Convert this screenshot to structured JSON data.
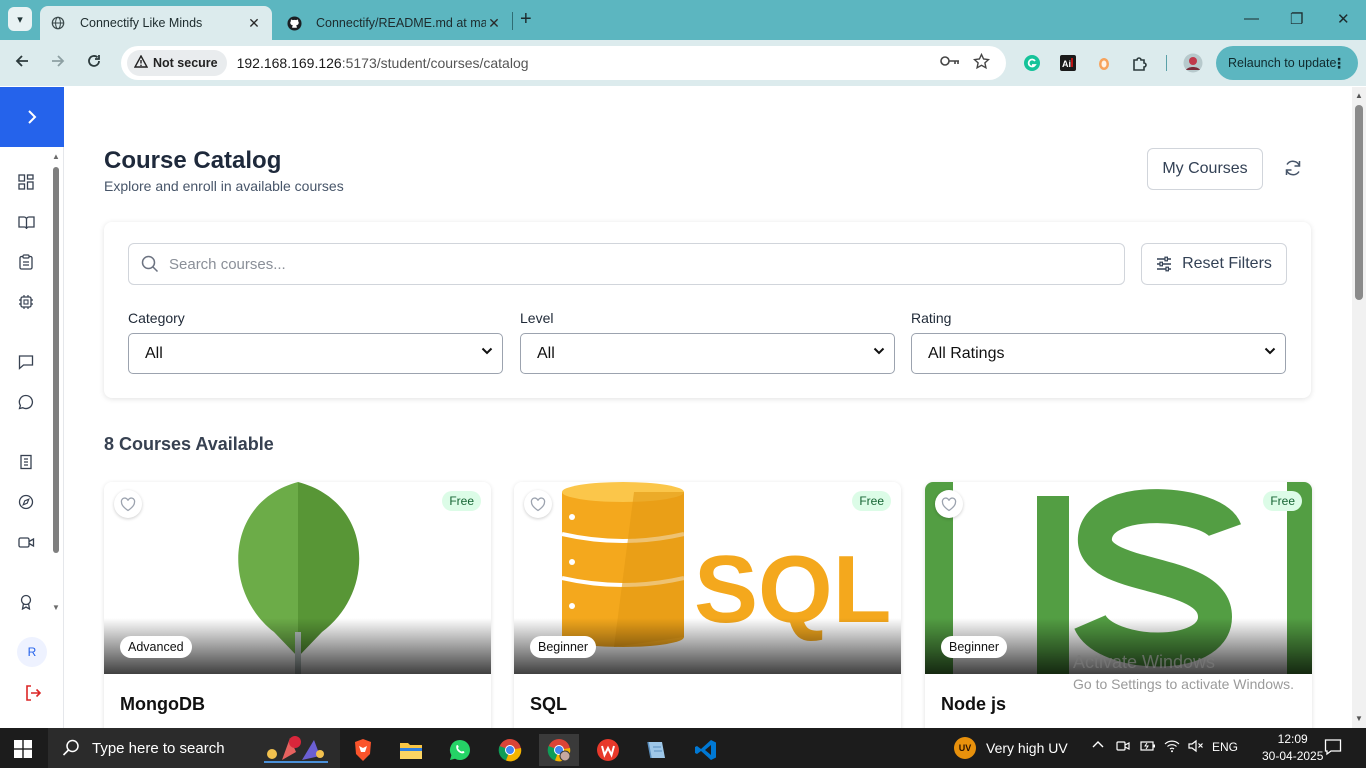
{
  "browser": {
    "tabs": [
      {
        "title": "Connectify Like Minds",
        "active": true
      },
      {
        "title": "Connectify/README.md at main",
        "active": false
      }
    ],
    "new_tab_symbol": "+",
    "not_secure_label": "Not secure",
    "url_host": "192.168.169.126",
    "url_path": ":5173/student/courses/catalog",
    "relaunch_label": "Relaunch to update",
    "relaunch_menu": "⋮"
  },
  "sidebar": {
    "avatar_initial": "R",
    "items": [
      "dashboard-icon",
      "book-icon",
      "clipboard-icon",
      "chip-icon",
      "message-square-icon",
      "message-circle-icon",
      "building-icon",
      "compass-icon",
      "video-icon",
      "award-icon"
    ]
  },
  "header": {
    "title": "Course Catalog",
    "subtitle": "Explore and enroll in available courses",
    "my_courses_label": "My Courses"
  },
  "filters": {
    "search_placeholder": "Search courses...",
    "reset_label": "Reset Filters",
    "category": {
      "label": "Category",
      "value": "All"
    },
    "level": {
      "label": "Level",
      "value": "All"
    },
    "rating": {
      "label": "Rating",
      "value": "All Ratings"
    }
  },
  "courses": {
    "count_label": "8 Courses Available",
    "items": [
      {
        "title": "MongoDB",
        "level": "Advanced",
        "price": "Free"
      },
      {
        "title": "SQL",
        "level": "Beginner",
        "price": "Free",
        "image_text": "SQL"
      },
      {
        "title": "Node js",
        "level": "Beginner",
        "price": "Free"
      }
    ]
  },
  "watermark": {
    "line1": "Activate Windows",
    "line2": "Go to Settings to activate Windows."
  },
  "taskbar": {
    "search_text": "Type here to search",
    "uv_badge": "UV",
    "weather": "Very high UV",
    "language": "ENG",
    "time": "12:09",
    "date": "30-04-2025"
  },
  "colors": {
    "chrome_tab_bar": "#5cb6c0",
    "chrome_toolbar": "#dcebed",
    "sidebar_accent": "#2563eb",
    "free_badge_bg": "#dcfce7",
    "free_badge_text": "#166534",
    "mongodb_green": "#589636",
    "sql_orange": "#f4a81d",
    "node_green": "#539e43"
  }
}
